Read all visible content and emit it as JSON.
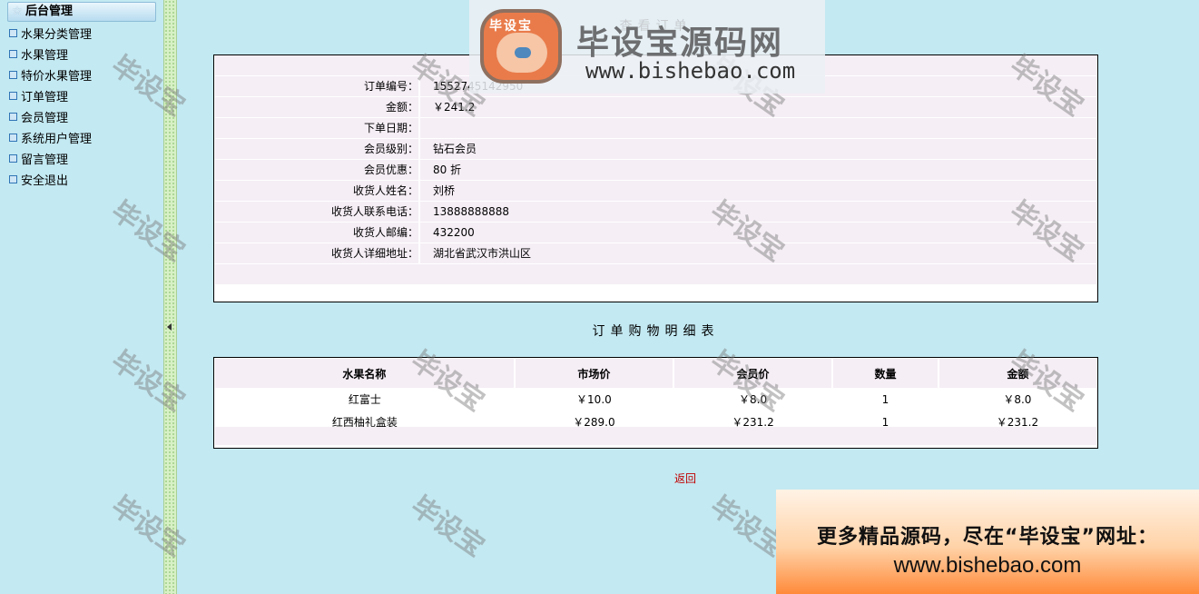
{
  "sidebar": {
    "header": "后台管理",
    "items": [
      {
        "label": "水果分类管理"
      },
      {
        "label": "水果管理"
      },
      {
        "label": "特价水果管理"
      },
      {
        "label": "订单管理"
      },
      {
        "label": "会员管理"
      },
      {
        "label": "系统用户管理"
      },
      {
        "label": "留言管理"
      },
      {
        "label": "安全退出"
      }
    ]
  },
  "order": {
    "title": "查看订单",
    "fields": [
      {
        "label": "订单编号：",
        "value": "1552745142950"
      },
      {
        "label": "金额：",
        "value": "￥241.2"
      },
      {
        "label": "下单日期：",
        "value": ""
      },
      {
        "label": "会员级别：",
        "value": "钻石会员"
      },
      {
        "label": "会员优惠：",
        "value": "80 折"
      },
      {
        "label": "收货人姓名：",
        "value": "刘桥"
      },
      {
        "label": "收货人联系电话：",
        "value": "13888888888"
      },
      {
        "label": "收货人邮编：",
        "value": "432200"
      },
      {
        "label": "收货人详细地址：",
        "value": "湖北省武汉市洪山区"
      }
    ]
  },
  "details": {
    "title": "订单购物明细表",
    "columns": [
      "水果名称",
      "市场价",
      "会员价",
      "数量",
      "金额"
    ],
    "rows": [
      [
        "红富士",
        "￥10.0",
        "￥8.0",
        "1",
        "￥8.0"
      ],
      [
        "红西柚礼盒装",
        "￥289.0",
        "￥231.2",
        "1",
        "￥231.2"
      ]
    ]
  },
  "back_link": "返回",
  "watermark": "毕设宝",
  "logo": {
    "badge": "毕设宝",
    "name": "毕设宝源码网",
    "url": "www.bishebao.com"
  },
  "banner": {
    "line1": "更多精品源码，尽在“毕设宝”网址：",
    "line2": "www.bishebao.com"
  },
  "colors": {
    "background": "#c3e9f2",
    "row_shade": "#f5eef5",
    "link_red": "#c00000"
  }
}
